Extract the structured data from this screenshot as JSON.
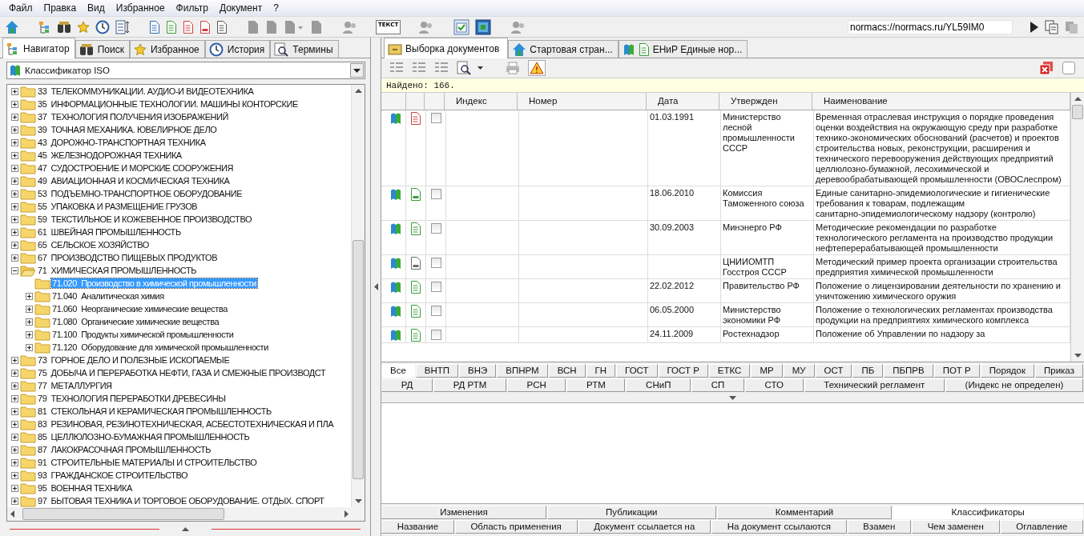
{
  "menu": [
    "Файл",
    "Правка",
    "Вид",
    "Избранное",
    "Фильтр",
    "Документ",
    "?"
  ],
  "toolbar": {
    "text_button_label": "ТЕКСТ",
    "address": "normacs://normacs.ru/YL59IM0"
  },
  "left_tabs": [
    {
      "label": "Навигатор",
      "selected": true
    },
    {
      "label": "Поиск",
      "selected": false
    },
    {
      "label": "Избранное",
      "selected": false
    },
    {
      "label": "История",
      "selected": false
    },
    {
      "label": "Термины",
      "selected": false
    }
  ],
  "classifier_select": {
    "value": "Классификатор ISO"
  },
  "tree": [
    {
      "label": "33  ТЕЛЕКОММУНИКАЦИИ. АУДИО-И ВИДЕОТЕХНИКА",
      "expandable": true,
      "expanded": false,
      "selected": false
    },
    {
      "label": "35  ИНФОРМАЦИОННЫЕ ТЕХНОЛОГИИ. МАШИНЫ КОНТОРСКИЕ",
      "expandable": true,
      "expanded": false,
      "selected": false
    },
    {
      "label": "37  ТЕХНОЛОГИЯ ПОЛУЧЕНИЯ ИЗОБРАЖЕНИЙ",
      "expandable": true,
      "expanded": false,
      "selected": false
    },
    {
      "label": "39  ТОЧНАЯ МЕХАНИКА. ЮВЕЛИРНОЕ ДЕЛО",
      "expandable": true,
      "expanded": false,
      "selected": false
    },
    {
      "label": "43  ДОРОЖНО-ТРАНСПОРТНАЯ ТЕХНИКА",
      "expandable": true,
      "expanded": false,
      "selected": false
    },
    {
      "label": "45  ЖЕЛЕЗНОДОРОЖНАЯ ТЕХНИКА",
      "expandable": true,
      "expanded": false,
      "selected": false
    },
    {
      "label": "47  СУДОСТРОЕНИЕ И МОРСКИЕ СООРУЖЕНИЯ",
      "expandable": true,
      "expanded": false,
      "selected": false
    },
    {
      "label": "49  АВИАЦИОННАЯ И КОСМИЧЕСКАЯ ТЕХНИКА",
      "expandable": true,
      "expanded": false,
      "selected": false
    },
    {
      "label": "53  ПОДЪЕМНО-ТРАНСПОРТНОЕ ОБОРУДОВАНИЕ",
      "expandable": true,
      "expanded": false,
      "selected": false
    },
    {
      "label": "55  УПАКОВКА И РАЗМЕЩЕНИЕ ГРУЗОВ",
      "expandable": true,
      "expanded": false,
      "selected": false
    },
    {
      "label": "59  ТЕКСТИЛЬНОЕ И КОЖЕВЕННОЕ ПРОИЗВОДСТВО",
      "expandable": true,
      "expanded": false,
      "selected": false
    },
    {
      "label": "61  ШВЕЙНАЯ ПРОМЫШЛЕННОСТЬ",
      "expandable": true,
      "expanded": false,
      "selected": false
    },
    {
      "label": "65  СЕЛЬСКОЕ ХОЗЯЙСТВО",
      "expandable": true,
      "expanded": false,
      "selected": false
    },
    {
      "label": "67  ПРОИЗВОДСТВО ПИЩЕВЫХ ПРОДУКТОВ",
      "expandable": true,
      "expanded": false,
      "selected": false
    },
    {
      "label": "71  ХИМИЧЕСКАЯ ПРОМЫШЛЕННОСТЬ",
      "expandable": true,
      "expanded": true,
      "selected": false,
      "children": [
        {
          "label": "71.020  Производство в химической промышленности",
          "expandable": false,
          "expanded": false,
          "selected": true
        },
        {
          "label": "71.040  Аналитическая химия",
          "expandable": true,
          "expanded": false,
          "selected": false
        },
        {
          "label": "71.060  Неорганические химические вещества",
          "expandable": true,
          "expanded": false,
          "selected": false
        },
        {
          "label": "71.080  Органические химические вещества",
          "expandable": true,
          "expanded": false,
          "selected": false
        },
        {
          "label": "71.100  Продукты химической промышленности",
          "expandable": true,
          "expanded": false,
          "selected": false
        },
        {
          "label": "71.120  Оборудование для химической промышленности",
          "expandable": true,
          "expanded": false,
          "selected": false
        }
      ]
    },
    {
      "label": "73  ГОРНОЕ ДЕЛО И ПОЛЕЗНЫЕ ИСКОПАЕМЫЕ",
      "expandable": true,
      "expanded": false,
      "selected": false
    },
    {
      "label": "75  ДОБЫЧА И ПЕРЕРАБОТКА НЕФТИ, ГАЗА И СМЕЖНЫЕ ПРОИЗВОДСТ",
      "expandable": true,
      "expanded": false,
      "selected": false
    },
    {
      "label": "77  МЕТАЛЛУРГИЯ",
      "expandable": true,
      "expanded": false,
      "selected": false
    },
    {
      "label": "79  ТЕХНОЛОГИЯ ПЕРЕРАБОТКИ ДРЕВЕСИНЫ",
      "expandable": true,
      "expanded": false,
      "selected": false
    },
    {
      "label": "81  СТЕКОЛЬНАЯ И КЕРАМИЧЕСКАЯ ПРОМЫШЛЕННОСТЬ",
      "expandable": true,
      "expanded": false,
      "selected": false
    },
    {
      "label": "83  РЕЗИНОВАЯ, РЕЗИНОТЕХНИЧЕСКАЯ, АСБЕСТОТЕХНИЧЕСКАЯ И ПЛА",
      "expandable": true,
      "expanded": false,
      "selected": false
    },
    {
      "label": "85  ЦЕЛЛЮЛОЗНО-БУМАЖНАЯ ПРОМЫШЛЕННОСТЬ",
      "expandable": true,
      "expanded": false,
      "selected": false
    },
    {
      "label": "87  ЛАКОКРАСОЧНАЯ ПРОМЫШЛЕННОСТЬ",
      "expandable": true,
      "expanded": false,
      "selected": false
    },
    {
      "label": "91  СТРОИТЕЛЬНЫЕ МАТЕРИАЛЫ И СТРОИТЕЛЬСТВО",
      "expandable": true,
      "expanded": false,
      "selected": false
    },
    {
      "label": "93  ГРАЖДАНСКОЕ СТРОИТЕЛЬСТВО",
      "expandable": true,
      "expanded": false,
      "selected": false
    },
    {
      "label": "95  ВОЕННАЯ ТЕХНИКА",
      "expandable": true,
      "expanded": false,
      "selected": false
    },
    {
      "label": "97  БЫТОВАЯ ТЕХНИКА И ТОРГОВОЕ ОБОРУДОВАНИЕ. ОТДЫХ. СПОРТ",
      "expandable": true,
      "expanded": false,
      "selected": false
    }
  ],
  "doc_tabs": [
    {
      "label": "Выборка документов",
      "selected": true
    },
    {
      "label": "Стартовая стран...",
      "selected": false
    },
    {
      "label": "ЕНиР Единые нор...",
      "selected": false
    }
  ],
  "found": "Найдено: 166.",
  "table": {
    "columns": [
      "Индекс",
      "Номер",
      "Дата",
      "Утвержден",
      "Наименование"
    ],
    "rows": [
      {
        "form": false,
        "color": "#d04040",
        "checked": false,
        "date": "01.03.1991",
        "approved": [
          "Министерство",
          "лесной",
          "промышленности",
          "СССР"
        ],
        "name": [
          "Временная отраслевая инструкция о порядке проведения",
          "оценки воздействия на окружающую среду при разработке",
          "технико-экономических обоснований (расчетов) и проектов",
          "строительства новых, реконструкции, расширения и",
          "технического перевооружения действующих предприятий",
          "целлюлозно-бумажной, лесохимической и",
          "деревообрабатывающей промышленности (ОВОСлеспром)"
        ]
      },
      {
        "form": true,
        "color": "#3a9a3a",
        "checked": false,
        "date": "18.06.2010",
        "approved": [
          "Комиссия",
          "Таможенного союза"
        ],
        "name": [
          "Единые санитарно-эпидемиологические и гигиенические",
          "требования к товарам, подлежащим",
          "санитарно-эпидемиологическому надзору (контролю)"
        ]
      },
      {
        "form": false,
        "color": "#3a9a3a",
        "checked": false,
        "date": "30.09.2003",
        "approved": [
          "Минэнерго РФ"
        ],
        "name": [
          "Методические рекомендации по разработке",
          "технологического регламента на производство продукции",
          "нефтеперерабатывающей промышленности"
        ]
      },
      {
        "form": true,
        "color": "#707070",
        "checked": false,
        "approved": [
          "ЦНИИОМТП",
          "Госстроя СССР"
        ],
        "name": [
          "Методический пример проекта организации строительства",
          "предприятия химической промышленности"
        ]
      },
      {
        "form": false,
        "color": "#3a9a3a",
        "checked": false,
        "date": "22.02.2012",
        "approved": [
          "Правительство РФ"
        ],
        "name": [
          "Положение о лицензировании деятельности по хранению и",
          "уничтожению химического оружия"
        ]
      },
      {
        "form": false,
        "color": "#3a9a3a",
        "checked": false,
        "date": "06.05.2000",
        "approved": [
          "Министерство",
          "экономики РФ"
        ],
        "name": [
          "Положение о технологических регламентах производства",
          "продукции на предприятиях химического комплекса"
        ]
      },
      {
        "form": false,
        "color": "#3a9a3a",
        "checked": false,
        "date": "24.11.2009",
        "approved": [
          "Ростехнадзор"
        ],
        "name": [
          "Положение об Управлении по надзору за"
        ]
      }
    ]
  },
  "filter_tabs": [
    [
      {
        "label": "Все",
        "selected": true
      },
      {
        "label": "ВНТП",
        "selected": false
      },
      {
        "label": "ВНЭ",
        "selected": false
      },
      {
        "label": "ВПНРМ",
        "selected": false
      },
      {
        "label": "ВСН",
        "selected": false
      },
      {
        "label": "ГН",
        "selected": false
      },
      {
        "label": "ГОСТ",
        "selected": false
      },
      {
        "label": "ГОСТ Р",
        "selected": false
      },
      {
        "label": "ЕТКС",
        "selected": false
      },
      {
        "label": "МР",
        "selected": false
      },
      {
        "label": "МУ",
        "selected": false
      },
      {
        "label": "ОСТ",
        "selected": false
      },
      {
        "label": "ПБ",
        "selected": false
      },
      {
        "label": "ПБПРВ",
        "selected": false
      },
      {
        "label": "ПОТ Р",
        "selected": false
      },
      {
        "label": "Порядок",
        "selected": false
      },
      {
        "label": "Приказ",
        "selected": false
      }
    ],
    [
      {
        "label": "РД",
        "selected": false
      },
      {
        "label": "РД РТМ",
        "selected": false
      },
      {
        "label": "РСН",
        "selected": false
      },
      {
        "label": "РТМ",
        "selected": false
      },
      {
        "label": "СНиП",
        "selected": false
      },
      {
        "label": "СП",
        "selected": false
      },
      {
        "label": "СТО",
        "selected": false
      },
      {
        "label": "Технический регламент",
        "selected": false
      },
      {
        "label": "(Индекс не определен)",
        "selected": false
      }
    ]
  ],
  "info_tabs": [
    [
      {
        "label": "Изменения",
        "selected": false
      },
      {
        "label": "Публикации",
        "selected": false
      },
      {
        "label": "Комментарий",
        "selected": false
      },
      {
        "label": "Классификаторы",
        "selected": true
      }
    ],
    [
      {
        "label": "Название",
        "selected": false
      },
      {
        "label": "Область применения",
        "selected": false
      },
      {
        "label": "Документ ссылается на",
        "selected": false
      },
      {
        "label": "На документ ссылаются",
        "selected": false
      },
      {
        "label": "Взамен",
        "selected": false
      },
      {
        "label": "Чем заменен",
        "selected": false
      },
      {
        "label": "Оглавление",
        "selected": false
      }
    ]
  ]
}
